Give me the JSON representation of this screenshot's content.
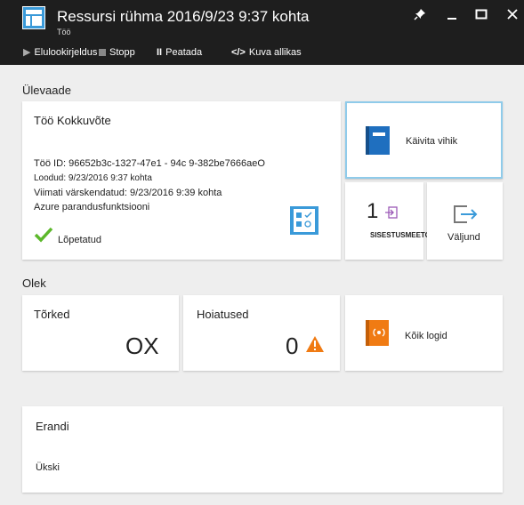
{
  "header": {
    "title": "Ressursi rühma 2016/9/23 9:37 kohta",
    "subtitle": "Töö",
    "window_buttons": [
      "pin-icon",
      "minimize-icon",
      "maximize-icon",
      "close-icon"
    ]
  },
  "toolbar": {
    "run_history_label": "Elulookirjeldus",
    "stop_label": "Stopp",
    "pause_label": "Peatada",
    "view_source_label": "Kuva allikas"
  },
  "overview": {
    "section_label": "Ülevaade",
    "summary": {
      "title": "Töö Kokkuvõte",
      "job_id": "Töö ID: 96652b3c-1327-47e1 - 94c 9-382be7666aeO",
      "created": "Loodud: 9/23/2016 9:37 kohta",
      "last_updated": "Viimati värskendatud: 9/23/2016 9:39 kohta",
      "runbook": "Azure parandusfunktsiooni",
      "status": "Lõpetatud"
    },
    "runbook_tile": {
      "label": "Käivita vihik"
    },
    "input_tile": {
      "count": "1",
      "label": "SISESTUSMEETODI"
    },
    "output_tile": {
      "label": "Väljund"
    }
  },
  "status": {
    "section_label": "Olek",
    "errors": {
      "label": "Tõrked",
      "value": "OX"
    },
    "warnings": {
      "label": "Hoiatused",
      "value": "0"
    },
    "all_logs": {
      "label": "Kõik logid"
    }
  },
  "exceptions": {
    "title": "Erandi",
    "value": "Ükski"
  },
  "colors": {
    "header_bg": "#1e1e1e",
    "accent_blue": "#3a9ad9",
    "runbook_icon": "#1f6fbf",
    "logs_icon": "#f07b13",
    "success_green": "#5cb82b",
    "warning_orange": "#f07b13",
    "selected_border": "#8fcbea"
  }
}
